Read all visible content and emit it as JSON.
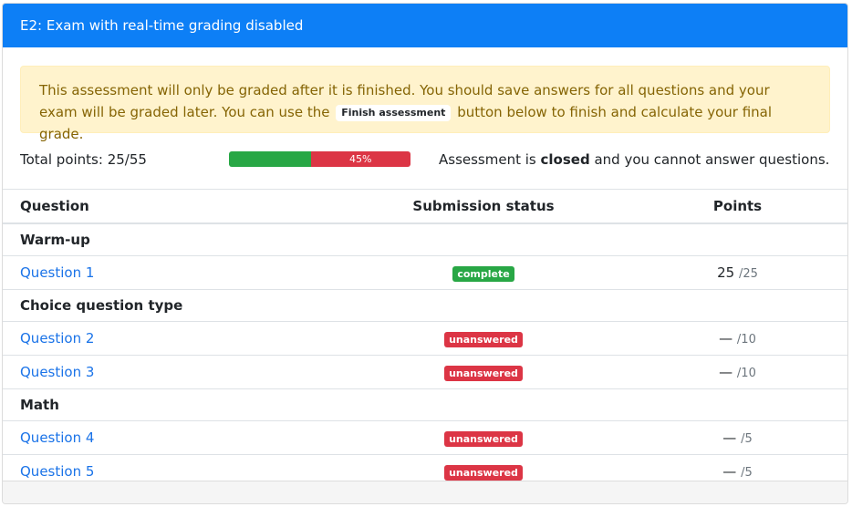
{
  "header": {
    "title": "E2: Exam with real-time grading disabled"
  },
  "alert": {
    "text_before": "This assessment will only be graded after it is finished. You should save answers for all questions and your exam will be graded later. You can use the",
    "button_label": "Finish assessment",
    "text_after": "button below to finish and calculate your final grade."
  },
  "summary": {
    "total_points": "Total points: 25/55",
    "progress_percent": 45,
    "progress_label": "45%",
    "status_prefix": "Assessment is",
    "status_word": "closed",
    "status_suffix": "and you cannot answer questions."
  },
  "table": {
    "headers": {
      "question": "Question",
      "status": "Submission status",
      "points": "Points"
    },
    "groups": [
      {
        "name": "Warm-up",
        "questions": [
          {
            "label": "Question 1",
            "status": "complete",
            "points": "25",
            "max": "/25"
          }
        ]
      },
      {
        "name": "Choice question type",
        "questions": [
          {
            "label": "Question 2",
            "status": "unanswered",
            "points": "—",
            "max": "/10"
          },
          {
            "label": "Question 3",
            "status": "unanswered",
            "points": "—",
            "max": "/10"
          }
        ]
      },
      {
        "name": "Math",
        "questions": [
          {
            "label": "Question 4",
            "status": "unanswered",
            "points": "—",
            "max": "/5"
          },
          {
            "label": "Question 5",
            "status": "unanswered",
            "points": "—",
            "max": "/5"
          }
        ]
      }
    ]
  },
  "colors": {
    "header_bg": "#0d7ff6",
    "complete": "#28a745",
    "unanswered": "#dc3545",
    "link": "#1a73e8",
    "alert_bg": "#fff3cd"
  }
}
